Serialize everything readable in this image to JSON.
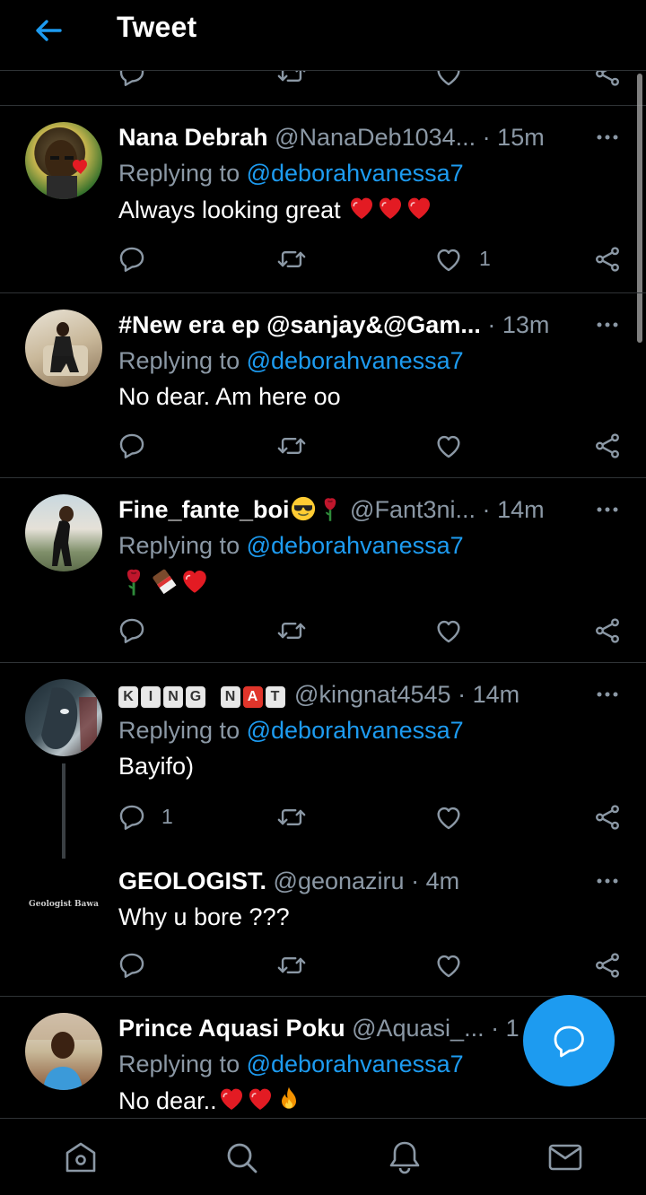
{
  "header": {
    "title": "Tweet"
  },
  "tweets": [
    {
      "name": "Nana Debrah",
      "handle": "@NanaDeb1034...",
      "time": "15m",
      "replying_label": "Replying to",
      "replying_to": "@deborahvanessa7",
      "text": "Always looking great",
      "likes": "1"
    },
    {
      "name": "#New era ep @sanjay&@Gam...",
      "time": "13m",
      "replying_label": "Replying to",
      "replying_to": "@deborahvanessa7",
      "text": "No dear. Am here oo"
    },
    {
      "name": "Fine_fante_boi",
      "handle": "@Fant3ni...",
      "time": "14m",
      "replying_label": "Replying to",
      "replying_to": "@deborahvanessa7"
    },
    {
      "name_boxes": [
        "K",
        "I",
        "N",
        "G",
        "N",
        "A",
        "T"
      ],
      "handle": "@kingnat4545",
      "time": "14m",
      "replying_label": "Replying to",
      "replying_to": "@deborahvanessa7",
      "text": "Bayifo)",
      "replies": "1"
    },
    {
      "name": "GEOLOGIST.",
      "handle": "@geonaziru",
      "time": "4m",
      "text": "Why u bore ???",
      "avatar_text": "Geologist Bawa"
    },
    {
      "name": "Prince Aquasi Poku",
      "handle": "@Aquasi_...",
      "time": "1",
      "replying_label": "Replying to",
      "replying_to": "@deborahvanessa7",
      "text": "No dear.."
    }
  ],
  "separator": "·",
  "colors": {
    "accent": "#1d9bf0",
    "muted": "#8b98a5",
    "heart": "#e0245e",
    "background": "#000000"
  },
  "nav_icons": [
    "home-icon",
    "search-icon",
    "notifications-icon",
    "messages-icon"
  ]
}
